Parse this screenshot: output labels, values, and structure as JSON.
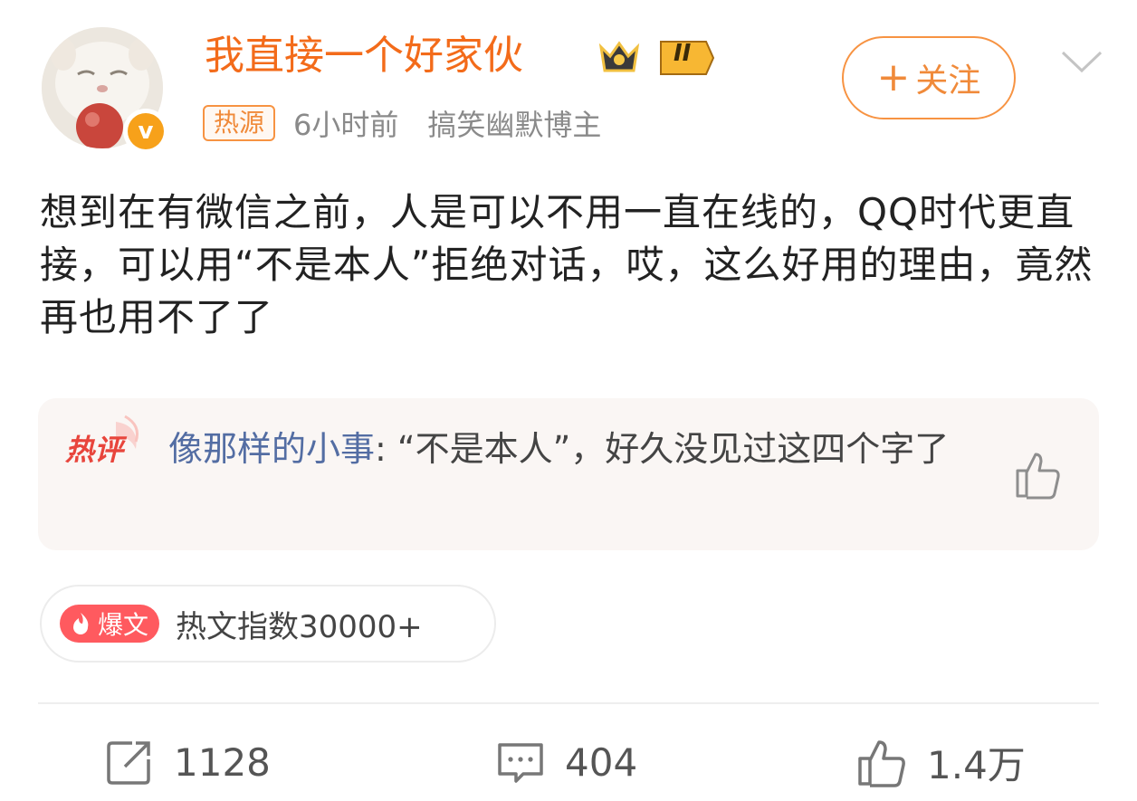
{
  "post": {
    "username": "我直接一个好家伙",
    "level_badge": "II",
    "tag": "热源",
    "time": "6小时前",
    "role": "搞笑幽默博主",
    "follow_label": "关注",
    "follow_plus": "+",
    "verified_mark": "v",
    "content": "想到在有微信之前，人是可以不用一直在线的，QQ时代更直接，可以用“不是本人”拒绝对话，哎，这么好用的理由，竟然再也用不了了"
  },
  "hot_comment": {
    "logo_text": "热评",
    "user": "像那样的小事",
    "separator": ": ",
    "text": "“不是本人”，好久没见过这四个字了"
  },
  "hot_index": {
    "badge": "爆文",
    "text": "热文指数30000+"
  },
  "actions": {
    "repost": "1128",
    "comment": "404",
    "like": "1.4万"
  },
  "colors": {
    "username": "#f36b1a",
    "accent": "#f79342",
    "comment_user": "#536da3",
    "burst": "#ff5a5f"
  }
}
